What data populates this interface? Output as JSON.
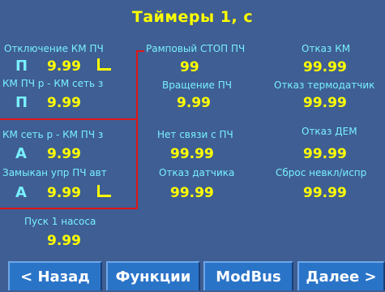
{
  "title": "Таймеры 1, с",
  "timers": [
    {
      "label": "Отключение КМ ПЧ",
      "mode": "П",
      "value": "9.99"
    },
    {
      "label": "КМ ПЧ р - КМ сеть з",
      "mode": "П",
      "value": "9.99"
    },
    {
      "label": "КМ сеть р - КМ ПЧ з",
      "mode": "А",
      "value": "9.99"
    },
    {
      "label": "Замыкан упр ПЧ авт",
      "mode": "А",
      "value": "9.99"
    },
    {
      "label": "Пуск 1 насоса",
      "value": "9.99"
    },
    {
      "label": "Рамповый СТОП ПЧ",
      "value": "99"
    },
    {
      "label": "Вращение ПЧ",
      "value": "9.99"
    },
    {
      "label": "Нет связи с ПЧ",
      "value": "99.99"
    },
    {
      "label": "Отказ датчика",
      "value": "99.99"
    },
    {
      "label": "Отказ КМ",
      "value": "99.99"
    },
    {
      "label": "Отказ термодатчик",
      "value": "99.99"
    },
    {
      "label": "Отказ ДЕМ",
      "value": "99.99"
    },
    {
      "label": "Сброс невкл/испр",
      "value": "99.99"
    }
  ],
  "nav": {
    "back": "< Назад",
    "functions": "Функции",
    "modbus": "ModBus",
    "next": "Далее >"
  },
  "colors": {
    "background": "#3f5e93",
    "label": "#78f0ff",
    "value": "#ffff00",
    "frame": "#e01616",
    "button": "#2a74c8"
  }
}
